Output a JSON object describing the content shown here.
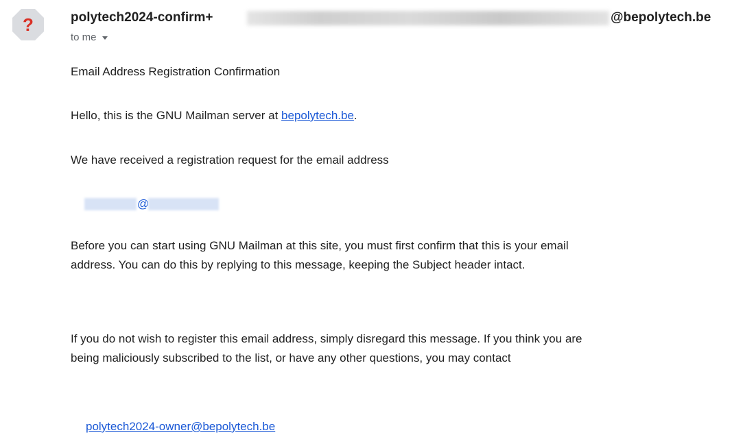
{
  "email": {
    "sender": {
      "name_prefix": "polytech2024-confirm+",
      "name_suffix": "@bepolytech.be",
      "avatar_glyph": "?",
      "avatar_icon": "unknown-sender-octagon-icon"
    },
    "recipient": {
      "label": "to me",
      "icon": "caret-down-icon"
    },
    "body": {
      "subject_line": "Email Address Registration Confirmation",
      "hello_prefix": "Hello, this is the GNU Mailman server at ",
      "hello_link": "bepolytech.be",
      "hello_suffix": ".",
      "received": "We have received a registration request for the email address",
      "address_at": "@",
      "before_paragraph": "Before you can start using GNU Mailman at this site, you must first confirm that this is your email address.  You can do this by replying to this message, keeping the Subject header intact.",
      "if_not_paragraph": "If you do not wish to register this email address, simply disregard this message.  If you think you are being maliciously subscribed to the list, or have any other questions, you may contact",
      "owner_link": "polytech2024-owner@bepolytech.be"
    }
  },
  "colors": {
    "link": "#1a58d6",
    "avatar_bg": "#dadce0",
    "avatar_glyph": "#d93025",
    "text": "#222222",
    "muted": "#5f6368"
  }
}
